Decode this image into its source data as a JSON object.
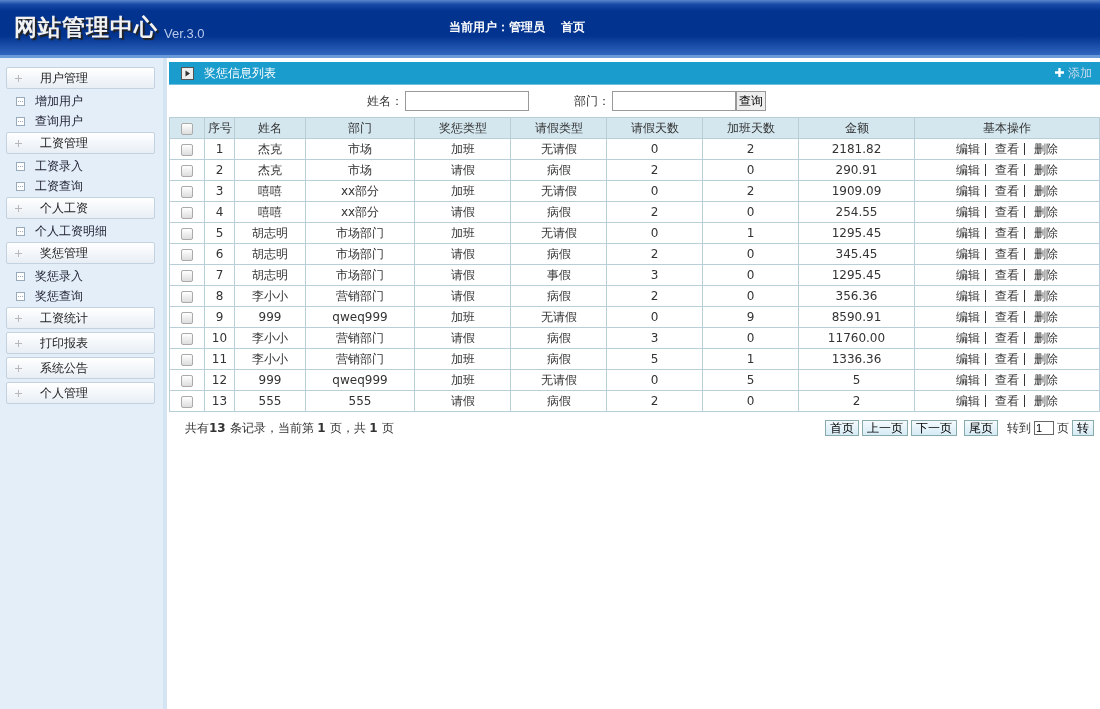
{
  "header": {
    "logo": "网站管理中心",
    "version": "Ver.3.0",
    "current_user": "当前用户：管理员",
    "home_link": "首页"
  },
  "sidebar": [
    {
      "label": "用户管理",
      "children": [
        {
          "label": "增加用户"
        },
        {
          "label": "查询用户"
        }
      ]
    },
    {
      "label": "工资管理",
      "children": [
        {
          "label": "工资录入"
        },
        {
          "label": "工资查询"
        }
      ]
    },
    {
      "label": "个人工资",
      "children": [
        {
          "label": "个人工资明细"
        }
      ]
    },
    {
      "label": "奖惩管理",
      "children": [
        {
          "label": "奖惩录入"
        },
        {
          "label": "奖惩查询"
        }
      ]
    },
    {
      "label": "工资统计"
    },
    {
      "label": "打印报表"
    },
    {
      "label": "系统公告"
    },
    {
      "label": "个人管理"
    }
  ],
  "panel": {
    "title": "奖惩信息列表",
    "add_button": "添加"
  },
  "search": {
    "name_label": "姓名：",
    "dept_label": "部门：",
    "button": "查询"
  },
  "table": {
    "columns": [
      "序号",
      "姓名",
      "部门",
      "奖惩类型",
      "请假类型",
      "请假天数",
      "加班天数",
      "金额",
      "基本操作"
    ],
    "rows": [
      {
        "checked": false,
        "cells": [
          "1",
          "杰克",
          "市场",
          "加班",
          "无请假",
          "0",
          "2",
          "2181.82"
        ],
        "actions": [
          "编辑",
          "查看",
          "删除"
        ]
      },
      {
        "checked": false,
        "cells": [
          "2",
          "杰克",
          "市场",
          "请假",
          "病假",
          "2",
          "0",
          "290.91"
        ],
        "actions": [
          "编辑",
          "查看",
          "删除"
        ]
      },
      {
        "checked": false,
        "cells": [
          "3",
          "嘻嘻",
          "xx部分",
          "加班",
          "无请假",
          "0",
          "2",
          "1909.09"
        ],
        "actions": [
          "编辑",
          "查看",
          "删除"
        ]
      },
      {
        "checked": false,
        "cells": [
          "4",
          "嘻嘻",
          "xx部分",
          "请假",
          "病假",
          "2",
          "0",
          "254.55"
        ],
        "actions": [
          "编辑",
          "查看",
          "删除"
        ]
      },
      {
        "checked": false,
        "cells": [
          "5",
          "胡志明",
          "市场部门",
          "加班",
          "无请假",
          "0",
          "1",
          "1295.45"
        ],
        "actions": [
          "编辑",
          "查看",
          "删除"
        ]
      },
      {
        "checked": false,
        "cells": [
          "6",
          "胡志明",
          "市场部门",
          "请假",
          "病假",
          "2",
          "0",
          "345.45"
        ],
        "actions": [
          "编辑",
          "查看",
          "删除"
        ]
      },
      {
        "checked": false,
        "cells": [
          "7",
          "胡志明",
          "市场部门",
          "请假",
          "事假",
          "3",
          "0",
          "1295.45"
        ],
        "actions": [
          "编辑",
          "查看",
          "删除"
        ]
      },
      {
        "checked": false,
        "cells": [
          "8",
          "李小小",
          "营销部门",
          "请假",
          "病假",
          "2",
          "0",
          "356.36"
        ],
        "actions": [
          "编辑",
          "查看",
          "删除"
        ]
      },
      {
        "checked": false,
        "cells": [
          "9",
          "999",
          "qweq999",
          "加班",
          "无请假",
          "0",
          "9",
          "8590.91"
        ],
        "actions": [
          "编辑",
          "查看",
          "删除"
        ]
      },
      {
        "checked": false,
        "cells": [
          "10",
          "李小小",
          "营销部门",
          "请假",
          "病假",
          "3",
          "0",
          "11760.00"
        ],
        "actions": [
          "编辑",
          "查看",
          "删除"
        ]
      },
      {
        "checked": false,
        "cells": [
          "11",
          "李小小",
          "营销部门",
          "加班",
          "病假",
          "5",
          "1",
          "1336.36"
        ],
        "actions": [
          "编辑",
          "查看",
          "删除"
        ]
      },
      {
        "checked": false,
        "cells": [
          "12",
          "999",
          "qweq999",
          "加班",
          "无请假",
          "0",
          "5",
          "5"
        ],
        "actions": [
          "编辑",
          "查看",
          "删除"
        ]
      },
      {
        "checked": false,
        "cells": [
          "13",
          "555",
          "555",
          "请假",
          "病假",
          "2",
          "0",
          "2"
        ],
        "actions": [
          "编辑",
          "查看",
          "删除"
        ]
      }
    ],
    "all_checked": false
  },
  "pagination": {
    "summary": "共有**13** 条记录，当前第 **1** 页，共 **1** 页",
    "buttons": [
      "首页",
      "上一页",
      "下一页",
      "尾页"
    ],
    "goto_label": "转到",
    "goto_value": "1",
    "page_unit": "页",
    "go_button": "转"
  }
}
